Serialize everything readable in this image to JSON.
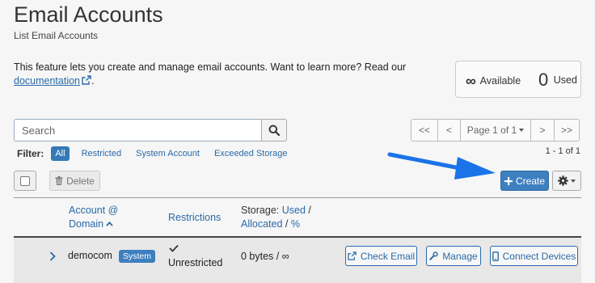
{
  "page": {
    "title": "Email Accounts",
    "subtitle": "List Email Accounts",
    "description": "This feature lets you create and manage email accounts. Want to learn more? Read our",
    "doc_link": "documentation",
    "desc_end": "."
  },
  "stats": {
    "available_value": "∞",
    "available_label": "Available",
    "used_value": "0",
    "used_label": "Used"
  },
  "search": {
    "placeholder": "Search",
    "value": ""
  },
  "pagination": {
    "first": "<<",
    "prev": "<",
    "current": "Page 1 of 1",
    "next": ">",
    "last": ">>",
    "range": "1 - 1 of 1"
  },
  "filter": {
    "label": "Filter:",
    "options": [
      "All",
      "Restricted",
      "System Account",
      "Exceeded Storage"
    ],
    "active": "All"
  },
  "toolbar": {
    "delete_label": "Delete",
    "create_label": "Create"
  },
  "table": {
    "col_account_1": "Account @",
    "col_account_2": "Domain",
    "col_restrictions": "Restrictions",
    "col_storage_prefix": "Storage:",
    "col_storage_used": "Used",
    "col_storage_sep1": "/",
    "col_storage_allocated": "Allocated",
    "col_storage_sep2": "/",
    "col_storage_pct": "%",
    "rows": [
      {
        "account": "democom",
        "badge": "System",
        "restriction": "Unrestricted",
        "storage": "0 bytes / ∞",
        "actions": [
          "Check Email",
          "Manage",
          "Connect Devices"
        ]
      }
    ]
  },
  "colors": {
    "primary": "#3e7fbf",
    "link": "#2a6aa8",
    "arrow": "#1a73e8",
    "background": "#f6f6f6"
  }
}
